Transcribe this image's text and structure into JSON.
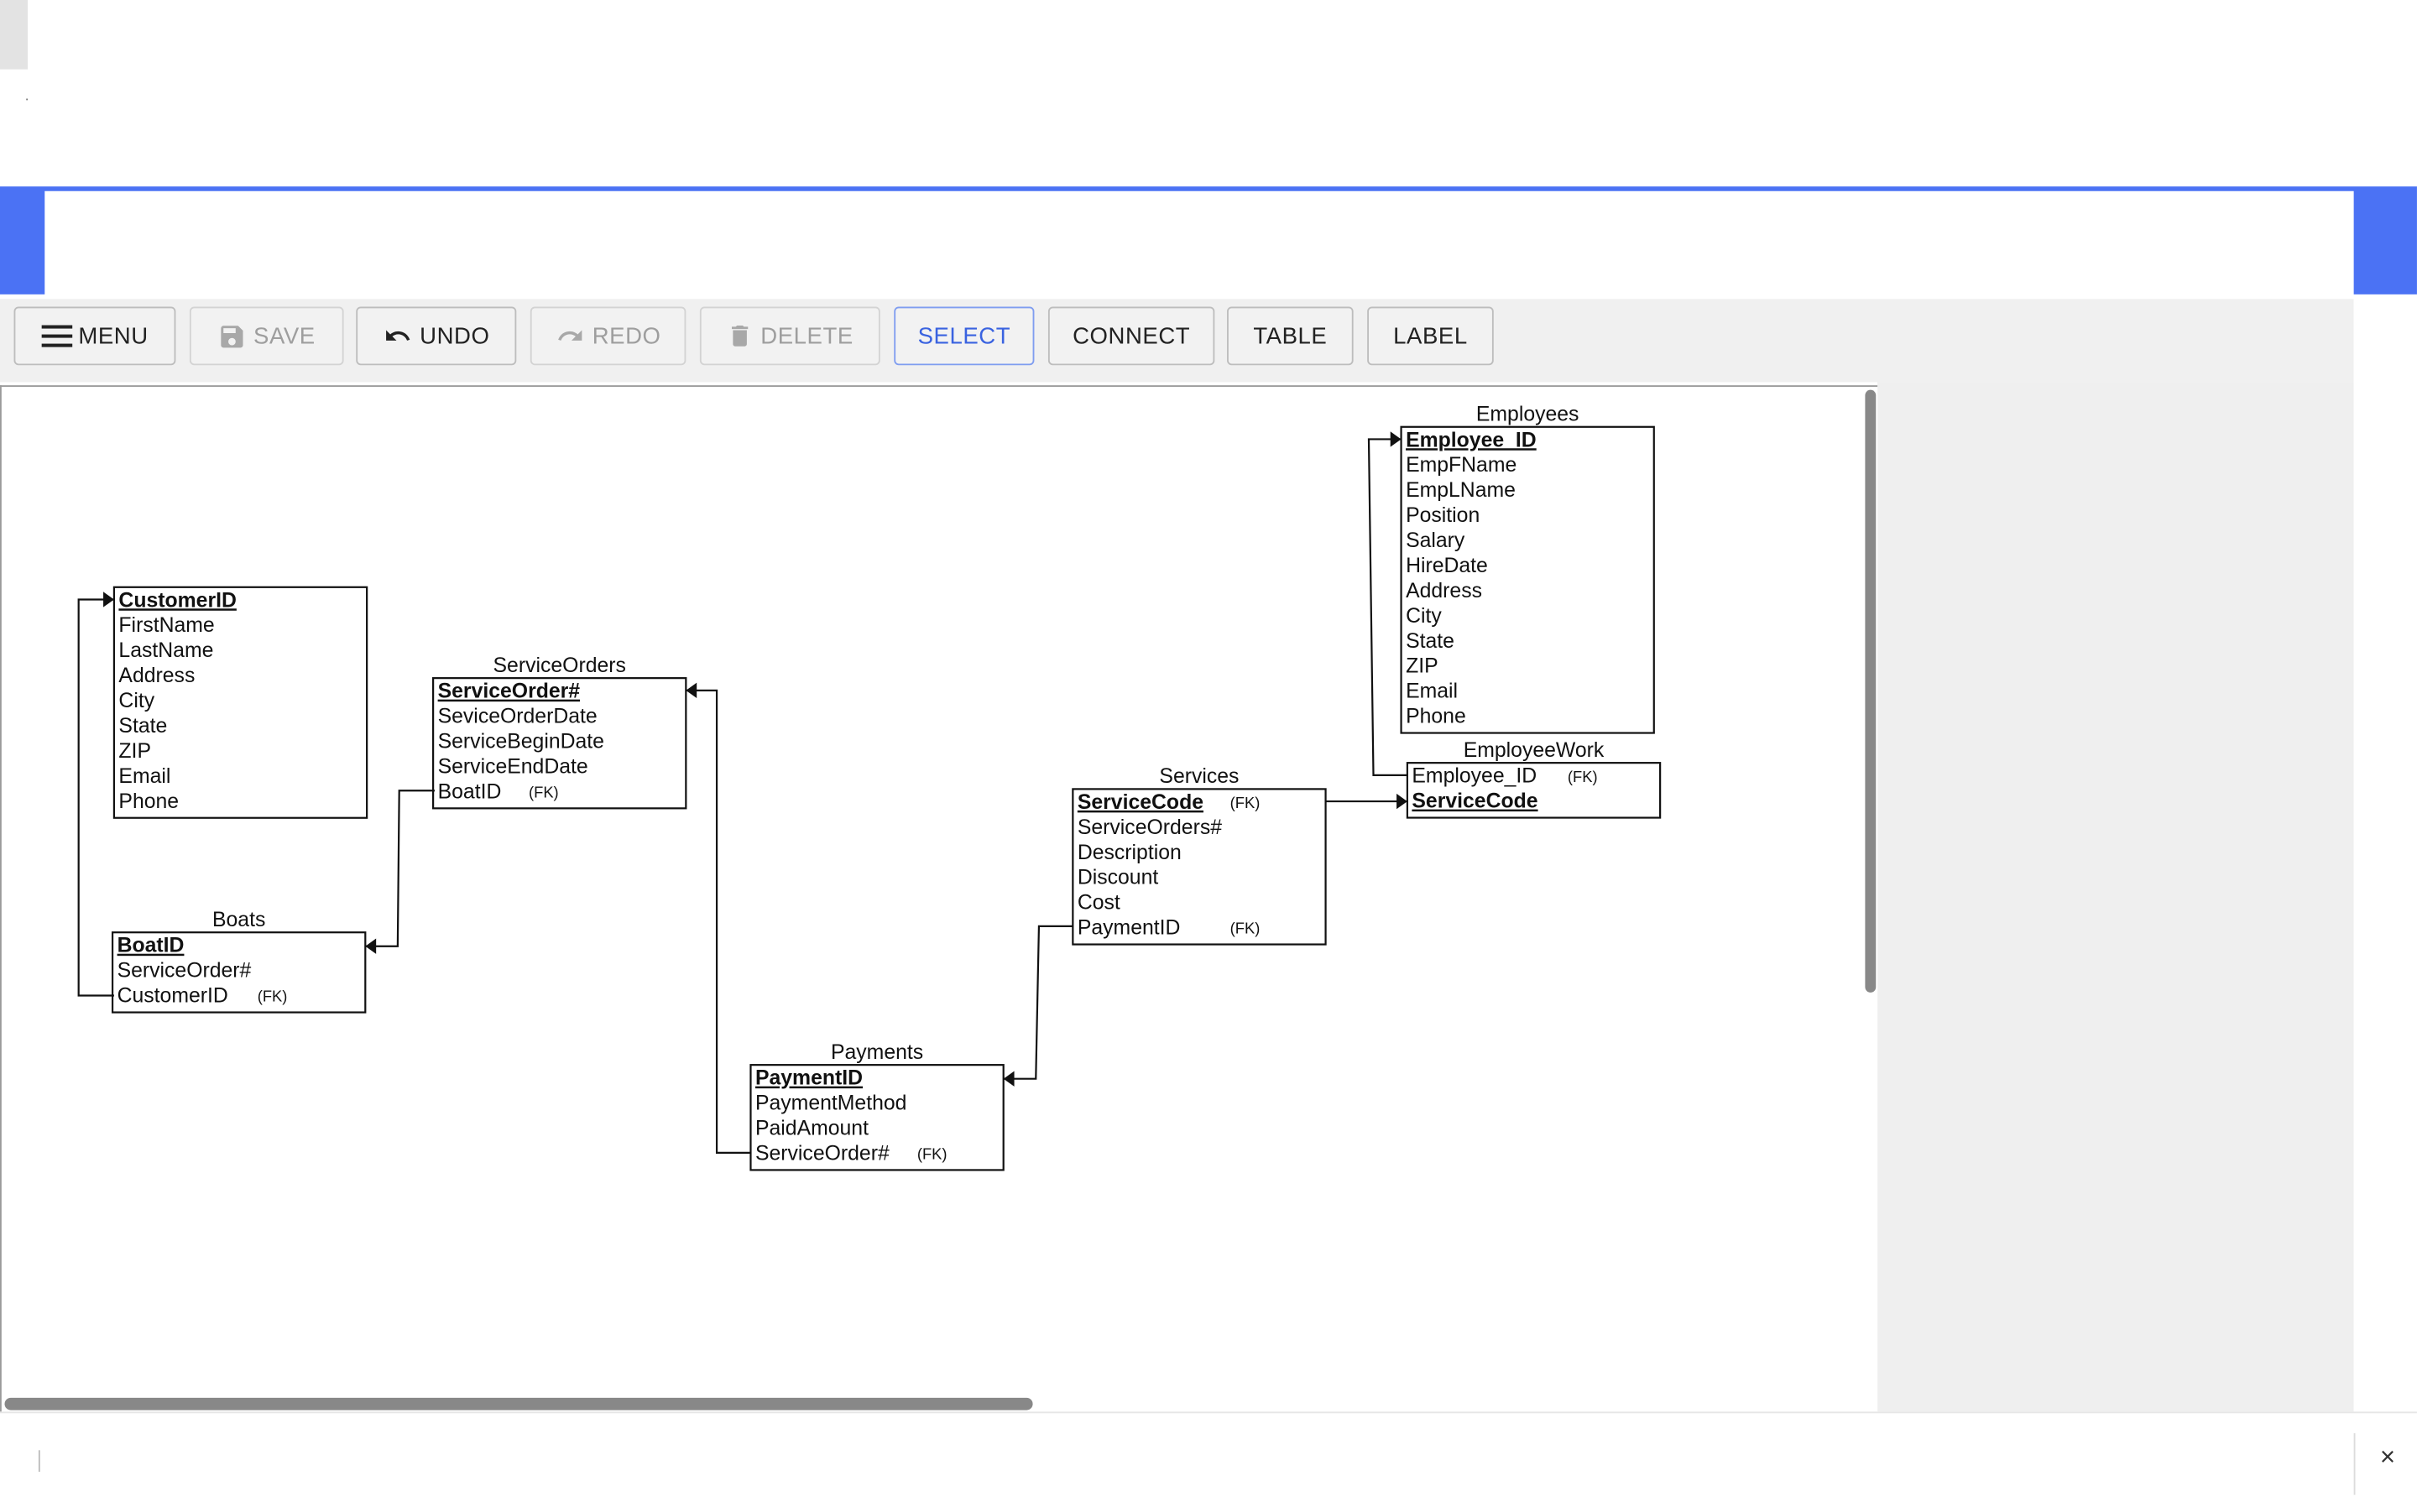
{
  "toolbar": {
    "menu": "MENU",
    "save": "SAVE",
    "undo": "UNDO",
    "redo": "REDO",
    "delete": "DELETE",
    "select": "SELECT",
    "connect": "CONNECT",
    "table": "TABLE",
    "label": "LABEL"
  },
  "footer": {
    "close_symbol": "×"
  },
  "colors": {
    "accent": "#4b72f4",
    "selected_text": "#3a63e0"
  },
  "tables": [
    {
      "id": "customers",
      "title": "",
      "fields": [
        {
          "name": "CustomerID",
          "pk": true,
          "fk": false
        },
        {
          "name": "FirstName",
          "pk": false,
          "fk": false
        },
        {
          "name": "LastName",
          "pk": false,
          "fk": false
        },
        {
          "name": "Address",
          "pk": false,
          "fk": false
        },
        {
          "name": "City",
          "pk": false,
          "fk": false
        },
        {
          "name": "State",
          "pk": false,
          "fk": false
        },
        {
          "name": "ZIP",
          "pk": false,
          "fk": false
        },
        {
          "name": "Email",
          "pk": false,
          "fk": false
        },
        {
          "name": "Phone",
          "pk": false,
          "fk": false
        }
      ]
    },
    {
      "id": "serviceorders",
      "title": "ServiceOrders",
      "fields": [
        {
          "name": "ServiceOrder#",
          "pk": true,
          "fk": false
        },
        {
          "name": "SeviceOrderDate",
          "pk": false,
          "fk": false
        },
        {
          "name": "ServiceBeginDate",
          "pk": false,
          "fk": false
        },
        {
          "name": "ServiceEndDate",
          "pk": false,
          "fk": false
        },
        {
          "name": "BoatID",
          "pk": false,
          "fk": true
        }
      ]
    },
    {
      "id": "boats",
      "title": "Boats",
      "fields": [
        {
          "name": "BoatID",
          "pk": true,
          "fk": false
        },
        {
          "name": "ServiceOrder#",
          "pk": false,
          "fk": false
        },
        {
          "name": "CustomerID",
          "pk": false,
          "fk": true
        }
      ]
    },
    {
      "id": "payments",
      "title": "Payments",
      "fields": [
        {
          "name": "PaymentID",
          "pk": true,
          "fk": false
        },
        {
          "name": "PaymentMethod",
          "pk": false,
          "fk": false
        },
        {
          "name": "PaidAmount",
          "pk": false,
          "fk": false
        },
        {
          "name": "ServiceOrder#",
          "pk": false,
          "fk": true
        }
      ]
    },
    {
      "id": "services",
      "title": "Services",
      "fields": [
        {
          "name": "ServiceCode",
          "pk": true,
          "fk": true
        },
        {
          "name": "ServiceOrders#",
          "pk": false,
          "fk": false
        },
        {
          "name": "Description",
          "pk": false,
          "fk": false
        },
        {
          "name": "Discount",
          "pk": false,
          "fk": false
        },
        {
          "name": "Cost",
          "pk": false,
          "fk": false
        },
        {
          "name": "PaymentID",
          "pk": false,
          "fk": true
        }
      ]
    },
    {
      "id": "employees",
      "title": "Employees",
      "fields": [
        {
          "name": "Employee_ID",
          "pk": true,
          "fk": false
        },
        {
          "name": "EmpFName",
          "pk": false,
          "fk": false
        },
        {
          "name": "EmpLName",
          "pk": false,
          "fk": false
        },
        {
          "name": "Position",
          "pk": false,
          "fk": false
        },
        {
          "name": "Salary",
          "pk": false,
          "fk": false
        },
        {
          "name": "HireDate",
          "pk": false,
          "fk": false
        },
        {
          "name": "Address",
          "pk": false,
          "fk": false
        },
        {
          "name": "City",
          "pk": false,
          "fk": false
        },
        {
          "name": "State",
          "pk": false,
          "fk": false
        },
        {
          "name": "ZIP",
          "pk": false,
          "fk": false
        },
        {
          "name": "Email",
          "pk": false,
          "fk": false
        },
        {
          "name": "Phone",
          "pk": false,
          "fk": false
        }
      ]
    },
    {
      "id": "employeework",
      "title": "EmployeeWork",
      "fields": [
        {
          "name": "Employee_ID",
          "pk": false,
          "fk": true
        },
        {
          "name": "ServiceCode",
          "pk": true,
          "fk": false
        }
      ]
    }
  ],
  "fk_marker": "(FK)",
  "relationships": [
    {
      "from": "boats.CustomerID",
      "to": "customers.CustomerID"
    },
    {
      "from": "serviceorders.BoatID",
      "to": "boats.BoatID"
    },
    {
      "from": "payments.ServiceOrder#",
      "to": "serviceorders.ServiceOrder#"
    },
    {
      "from": "services.PaymentID",
      "to": "payments.PaymentID"
    },
    {
      "from": "services.ServiceCode",
      "to": "employeework.ServiceCode"
    },
    {
      "from": "employeework.Employee_ID",
      "to": "employees.Employee_ID"
    }
  ]
}
